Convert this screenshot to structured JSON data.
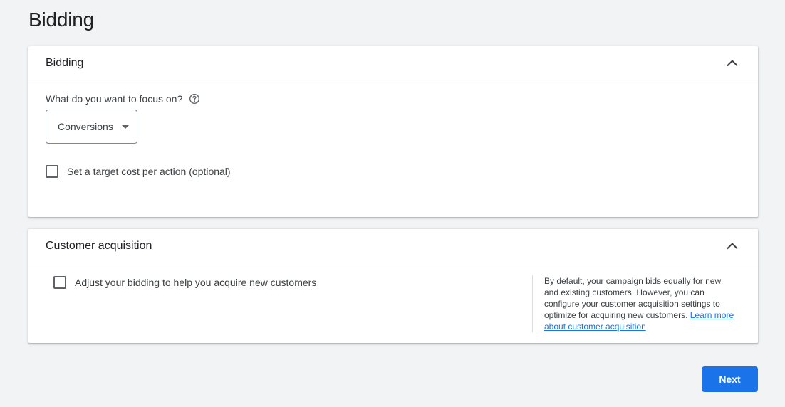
{
  "page": {
    "title": "Bidding"
  },
  "bidding_card": {
    "header_title": "Bidding",
    "collapse_icon": "chevron-up-icon",
    "focus_label": "What do you want to focus on?",
    "help_icon": "help-circle-icon",
    "focus_dropdown": {
      "selected": "Conversions",
      "arrow_icon": "dropdown-arrow-icon"
    },
    "target_cpa_checkbox": {
      "label": "Set a target cost per action (optional)",
      "checked": false
    }
  },
  "acquisition_card": {
    "header_title": "Customer acquisition",
    "collapse_icon": "chevron-up-icon",
    "acquire_checkbox": {
      "label": "Adjust your bidding to help you acquire new customers",
      "checked": false
    },
    "info_text": "By default, your campaign bids equally for new and existing customers. However, you can configure your customer acquisition settings to optimize for acquiring new customers.",
    "info_link": "Learn more about customer acquisition"
  },
  "footer": {
    "next_label": "Next"
  },
  "colors": {
    "background": "#f1f3f4",
    "primary": "#1a73e8",
    "text": "#3c4043",
    "divider": "#dadce0"
  }
}
